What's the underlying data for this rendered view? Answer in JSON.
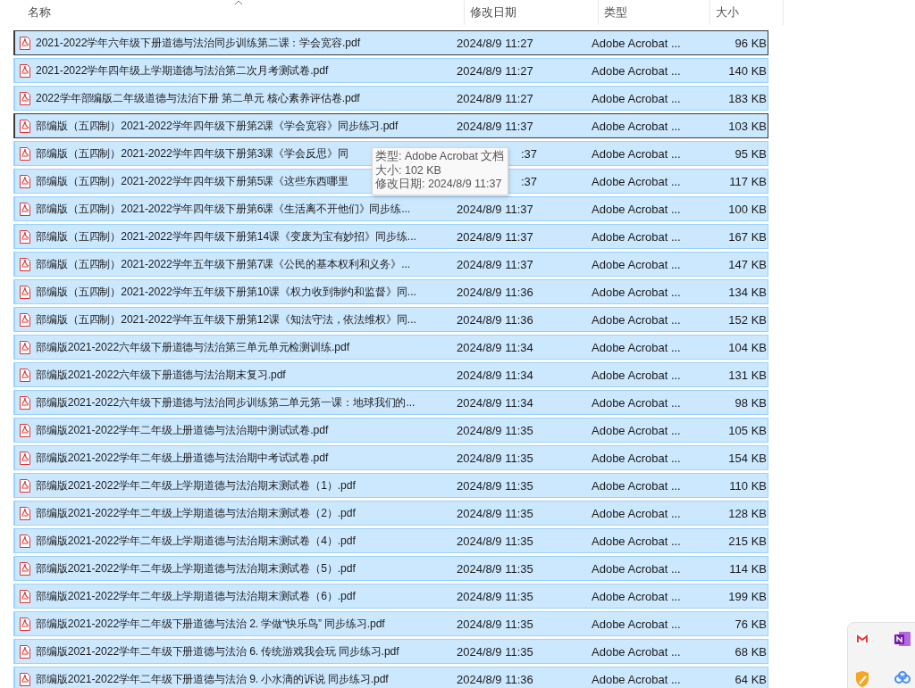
{
  "columns": [
    {
      "label": "名称",
      "sorted": true
    },
    {
      "label": "修改日期",
      "sorted": false
    },
    {
      "label": "类型",
      "sorted": false
    },
    {
      "label": "大小",
      "sorted": false
    }
  ],
  "files": [
    {
      "name": "2021-2022学年六年级下册道德与法治同步训练第二课：学会宽容.pdf",
      "date": "2024/8/9 11:27",
      "type": "Adobe Acrobat ...",
      "size": "96 KB",
      "selected": true,
      "focused": true,
      "covered": false
    },
    {
      "name": "2021-2022学年四年级上学期道德与法治第二次月考测试卷.pdf",
      "date": "2024/8/9 11:27",
      "type": "Adobe Acrobat ...",
      "size": "140 KB",
      "selected": true,
      "focused": false,
      "covered": false
    },
    {
      "name": "2022学年部编版二年级道德与法治下册 第二单元 核心素养评估卷.pdf",
      "date": "2024/8/9 11:27",
      "type": "Adobe Acrobat ...",
      "size": "183 KB",
      "selected": true,
      "focused": false,
      "covered": false
    },
    {
      "name": "部编版（五四制）2021-2022学年四年级下册第2课《学会宽容》同步练习.pdf",
      "date": "2024/8/9 11:37",
      "type": "Adobe Acrobat ...",
      "size": "103 KB",
      "selected": true,
      "focused": true,
      "covered": false
    },
    {
      "name": "部编版（五四制）2021-2022学年四年级下册第3课《学会反思》同",
      "date": ":37",
      "type": "Adobe Acrobat ...",
      "size": "95 KB",
      "selected": true,
      "focused": false,
      "covered": true
    },
    {
      "name": "部编版（五四制）2021-2022学年四年级下册第5课《这些东西哪里",
      "date": ":37",
      "type": "Adobe Acrobat ...",
      "size": "117 KB",
      "selected": true,
      "focused": false,
      "covered": true
    },
    {
      "name": "部编版（五四制）2021-2022学年四年级下册第6课《生活离不开他们》同步练...",
      "date": "2024/8/9 11:37",
      "type": "Adobe Acrobat ...",
      "size": "100 KB",
      "selected": true,
      "focused": false,
      "covered": false
    },
    {
      "name": "部编版（五四制）2021-2022学年四年级下册第14课《变废为宝有妙招》同步练...",
      "date": "2024/8/9 11:37",
      "type": "Adobe Acrobat ...",
      "size": "167 KB",
      "selected": true,
      "focused": false,
      "covered": false
    },
    {
      "name": "部编版（五四制）2021-2022学年五年级下册第7课《公民的基本权利和义务》...",
      "date": "2024/8/9 11:37",
      "type": "Adobe Acrobat ...",
      "size": "147 KB",
      "selected": true,
      "focused": false,
      "covered": false
    },
    {
      "name": "部编版（五四制）2021-2022学年五年级下册第10课《权力收到制约和监督》同...",
      "date": "2024/8/9 11:36",
      "type": "Adobe Acrobat ...",
      "size": "134 KB",
      "selected": true,
      "focused": false,
      "covered": false
    },
    {
      "name": "部编版（五四制）2021-2022学年五年级下册第12课《知法守法，依法维权》同...",
      "date": "2024/8/9 11:36",
      "type": "Adobe Acrobat ...",
      "size": "152 KB",
      "selected": true,
      "focused": false,
      "covered": false
    },
    {
      "name": "部编版2021-2022六年级下册道德与法治第三单元单元检测训练.pdf",
      "date": "2024/8/9 11:34",
      "type": "Adobe Acrobat ...",
      "size": "104 KB",
      "selected": true,
      "focused": false,
      "covered": false
    },
    {
      "name": "部编版2021-2022六年级下册道德与法治期末复习.pdf",
      "date": "2024/8/9 11:34",
      "type": "Adobe Acrobat ...",
      "size": "131 KB",
      "selected": true,
      "focused": false,
      "covered": false
    },
    {
      "name": "部编版2021-2022六年级下册道德与法治同步训练第二单元第一课：地球我们的...",
      "date": "2024/8/9 11:34",
      "type": "Adobe Acrobat ...",
      "size": "98 KB",
      "selected": true,
      "focused": false,
      "covered": false
    },
    {
      "name": "部编版2021-2022学年二年级上册道德与法治期中测试试卷.pdf",
      "date": "2024/8/9 11:35",
      "type": "Adobe Acrobat ...",
      "size": "105 KB",
      "selected": true,
      "focused": false,
      "covered": false
    },
    {
      "name": "部编版2021-2022学年二年级上册道德与法治期中考试试卷.pdf",
      "date": "2024/8/9 11:35",
      "type": "Adobe Acrobat ...",
      "size": "154 KB",
      "selected": true,
      "focused": false,
      "covered": false
    },
    {
      "name": "部编版2021-2022学年二年级上学期道德与法治期末测试卷（1）.pdf",
      "date": "2024/8/9 11:35",
      "type": "Adobe Acrobat ...",
      "size": "110 KB",
      "selected": true,
      "focused": false,
      "covered": false
    },
    {
      "name": "部编版2021-2022学年二年级上学期道德与法治期末测试卷（2）.pdf",
      "date": "2024/8/9 11:35",
      "type": "Adobe Acrobat ...",
      "size": "128 KB",
      "selected": true,
      "focused": false,
      "covered": false
    },
    {
      "name": "部编版2021-2022学年二年级上学期道德与法治期末测试卷（4）.pdf",
      "date": "2024/8/9 11:35",
      "type": "Adobe Acrobat ...",
      "size": "215 KB",
      "selected": true,
      "focused": false,
      "covered": false
    },
    {
      "name": "部编版2021-2022学年二年级上学期道德与法治期末测试卷（5）.pdf",
      "date": "2024/8/9 11:35",
      "type": "Adobe Acrobat ...",
      "size": "114 KB",
      "selected": true,
      "focused": false,
      "covered": false
    },
    {
      "name": "部编版2021-2022学年二年级上学期道德与法治期末测试卷（6）.pdf",
      "date": "2024/8/9 11:35",
      "type": "Adobe Acrobat ...",
      "size": "199 KB",
      "selected": true,
      "focused": false,
      "covered": false
    },
    {
      "name": "部编版2021-2022学年二年级下册道德与法治 2. 学做“快乐鸟” 同步练习.pdf",
      "date": "2024/8/9 11:35",
      "type": "Adobe Acrobat ...",
      "size": "76 KB",
      "selected": true,
      "focused": false,
      "covered": false
    },
    {
      "name": "部编版2021-2022学年二年级下册道德与法治 6. 传统游戏我会玩 同步练习.pdf",
      "date": "2024/8/9 11:35",
      "type": "Adobe Acrobat ...",
      "size": "68 KB",
      "selected": true,
      "focused": false,
      "covered": false
    },
    {
      "name": "部编版2021-2022学年二年级下册道德与法治 9. 小水滴的诉说 同步练习.pdf",
      "date": "2024/8/9 11:36",
      "type": "Adobe Acrobat ...",
      "size": "64 KB",
      "selected": true,
      "focused": false,
      "covered": false
    }
  ],
  "tooltip": {
    "lines": [
      "类型: Adobe Acrobat 文档",
      "大小: 102 KB",
      "修改日期: 2024/8/9 11:37"
    ]
  },
  "tray_popup": {
    "apps": [
      {
        "kind": "mail"
      },
      {
        "kind": "notes"
      },
      {
        "kind": "shield"
      },
      {
        "kind": "cloud"
      }
    ]
  }
}
